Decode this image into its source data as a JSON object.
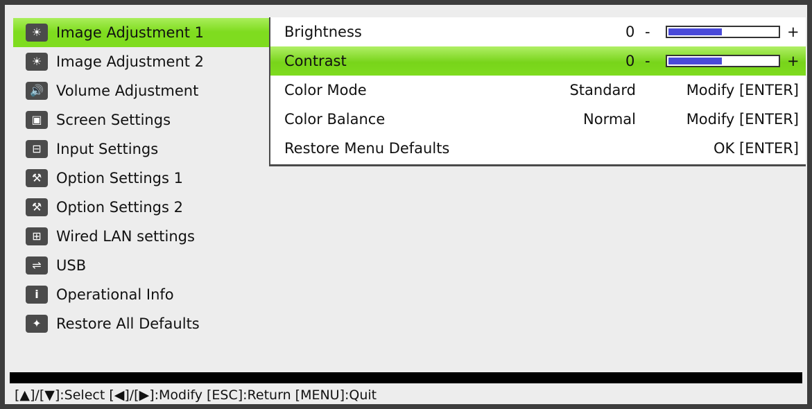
{
  "menu": {
    "items": [
      {
        "label": "Image Adjustment 1",
        "icon": "sun",
        "icon_glyph": "☀",
        "selected": true
      },
      {
        "label": "Image Adjustment 2",
        "icon": "sun",
        "icon_glyph": "☀",
        "selected": false
      },
      {
        "label": "Volume Adjustment",
        "icon": "speaker",
        "icon_glyph": "🔊",
        "selected": false
      },
      {
        "label": "Screen Settings",
        "icon": "screen",
        "icon_glyph": "▣",
        "selected": false
      },
      {
        "label": "Input Settings",
        "icon": "plug",
        "icon_glyph": "⊟",
        "selected": false
      },
      {
        "label": "Option Settings 1",
        "icon": "wrench",
        "icon_glyph": "⚒",
        "selected": false
      },
      {
        "label": "Option Settings 2",
        "icon": "wrench",
        "icon_glyph": "⚒",
        "selected": false
      },
      {
        "label": "Wired LAN settings",
        "icon": "network",
        "icon_glyph": "⊞",
        "selected": false
      },
      {
        "label": "USB",
        "icon": "usb",
        "icon_glyph": "⇌",
        "selected": false
      },
      {
        "label": "Operational Info",
        "icon": "info",
        "icon_glyph": "i",
        "selected": false
      },
      {
        "label": "Restore All Defaults",
        "icon": "sparkle",
        "icon_glyph": "✦",
        "selected": false
      }
    ]
  },
  "submenu": {
    "brightness": {
      "label": "Brightness",
      "value": "0",
      "minus": "-",
      "plus": "+",
      "level": 0.5
    },
    "contrast": {
      "label": "Contrast",
      "value": "0",
      "minus": "-",
      "plus": "+",
      "level": 0.5
    },
    "color_mode": {
      "label": "Color Mode",
      "value": "Standard",
      "action": "Modify [ENTER]"
    },
    "color_balance": {
      "label": "Color Balance",
      "value": "Normal",
      "action": "Modify [ENTER]"
    },
    "restore": {
      "label": "Restore Menu Defaults",
      "action": "OK [ENTER]"
    }
  },
  "status_bar": {
    "text": "[▲]/[▼]:Select [◀]/[▶]:Modify [ESC]:Return [MENU]:Quit"
  },
  "colors": {
    "selection": "#7fdc1f",
    "slider_fill": "#4a4ad8",
    "frame": "#3d3d3d"
  }
}
